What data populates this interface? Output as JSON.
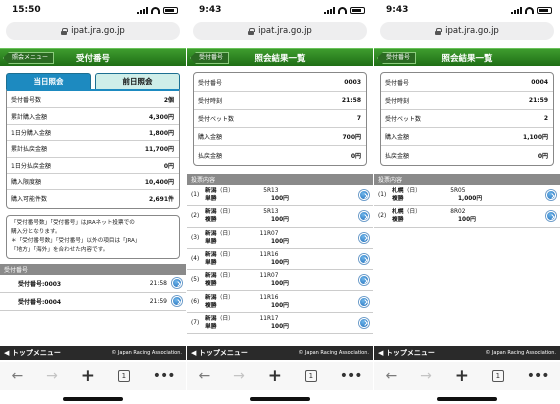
{
  "url": "ipat.jra.go.jp",
  "footer": {
    "menu": "◀ トップメニュー",
    "copyright": "© Japan Racing Association."
  },
  "screen1": {
    "time": "15:50",
    "back_label": "照会メニュー",
    "title": "受付番号",
    "tabs": {
      "active": "当日照会",
      "inactive": "前日照会"
    },
    "rows": [
      {
        "label": "受付番号数",
        "value": "2個"
      },
      {
        "label": "累計購入金額",
        "value": "4,300円"
      },
      {
        "label": "1日分購入金額",
        "value": "1,800円"
      },
      {
        "label": "累計払戻金額",
        "value": "11,700円"
      },
      {
        "label": "1日分払戻金額",
        "value": "0円"
      },
      {
        "label": "購入限度額",
        "value": "10,400円"
      },
      {
        "label": "購入可能件数",
        "value": "2,691件"
      }
    ],
    "note": {
      "line1": "「受付番号数」「受付番号」はJRAネット投票での",
      "line2": "購入分となります。",
      "line3": "＊「受付番号数」「受付番号」以外の項目は「JRA」",
      "line4": "「地方」「海外」を合わせた内容です。"
    },
    "section": "受付番号",
    "list": [
      {
        "label": "受付番号:0003",
        "time": "21:58"
      },
      {
        "label": "受付番号:0004",
        "time": "21:59"
      }
    ]
  },
  "screen2": {
    "time": "9:43",
    "back_label": "受付番号",
    "title": "照会結果一覧",
    "rows": [
      {
        "label": "受付番号",
        "value": "0003"
      },
      {
        "label": "受付時刻",
        "value": "21:58"
      },
      {
        "label": "受付ベット数",
        "value": "7"
      },
      {
        "label": "購入金額",
        "value": "700円"
      },
      {
        "label": "払戻金額",
        "value": "0円"
      }
    ],
    "section": "投票内容",
    "votes": [
      {
        "num": "(1)",
        "place": "新潟",
        "day": "（日）",
        "race": "5R",
        "type": "単勝",
        "horse": "13",
        "amount": "100円"
      },
      {
        "num": "(2)",
        "place": "新潟",
        "day": "（日）",
        "race": "5R",
        "type": "複勝",
        "horse": "13",
        "amount": "100円"
      },
      {
        "num": "(3)",
        "place": "新潟",
        "day": "（日）",
        "race": "11R",
        "type": "単勝",
        "horse": "07",
        "amount": "100円"
      },
      {
        "num": "(4)",
        "place": "新潟",
        "day": "（日）",
        "race": "11R",
        "type": "単勝",
        "horse": "16",
        "amount": "100円"
      },
      {
        "num": "(5)",
        "place": "新潟",
        "day": "（日）",
        "race": "11R",
        "type": "複勝",
        "horse": "07",
        "amount": "100円"
      },
      {
        "num": "(6)",
        "place": "新潟",
        "day": "（日）",
        "race": "11R",
        "type": "複勝",
        "horse": "16",
        "amount": "100円"
      },
      {
        "num": "(7)",
        "place": "新潟",
        "day": "（日）",
        "race": "11R",
        "type": "単勝",
        "horse": "17",
        "amount": "100円"
      }
    ]
  },
  "screen3": {
    "time": "9:43",
    "back_label": "受付番号",
    "title": "照会結果一覧",
    "rows": [
      {
        "label": "受付番号",
        "value": "0004"
      },
      {
        "label": "受付時刻",
        "value": "21:59"
      },
      {
        "label": "受付ベット数",
        "value": "2"
      },
      {
        "label": "購入金額",
        "value": "1,100円"
      },
      {
        "label": "払戻金額",
        "value": "0円"
      }
    ],
    "section": "投票内容",
    "votes": [
      {
        "num": "(1)",
        "place": "札幌",
        "day": "（日）",
        "race": "5R",
        "type": "複勝",
        "horse": "05",
        "amount": "1,000円"
      },
      {
        "num": "(2)",
        "place": "札幌",
        "day": "（日）",
        "race": "8R",
        "type": "複勝",
        "horse": "02",
        "amount": "100円"
      }
    ]
  },
  "toolbar": {
    "back": "←",
    "forward": "→",
    "new_tab": "+",
    "tab_count": "1",
    "more": "•••"
  }
}
